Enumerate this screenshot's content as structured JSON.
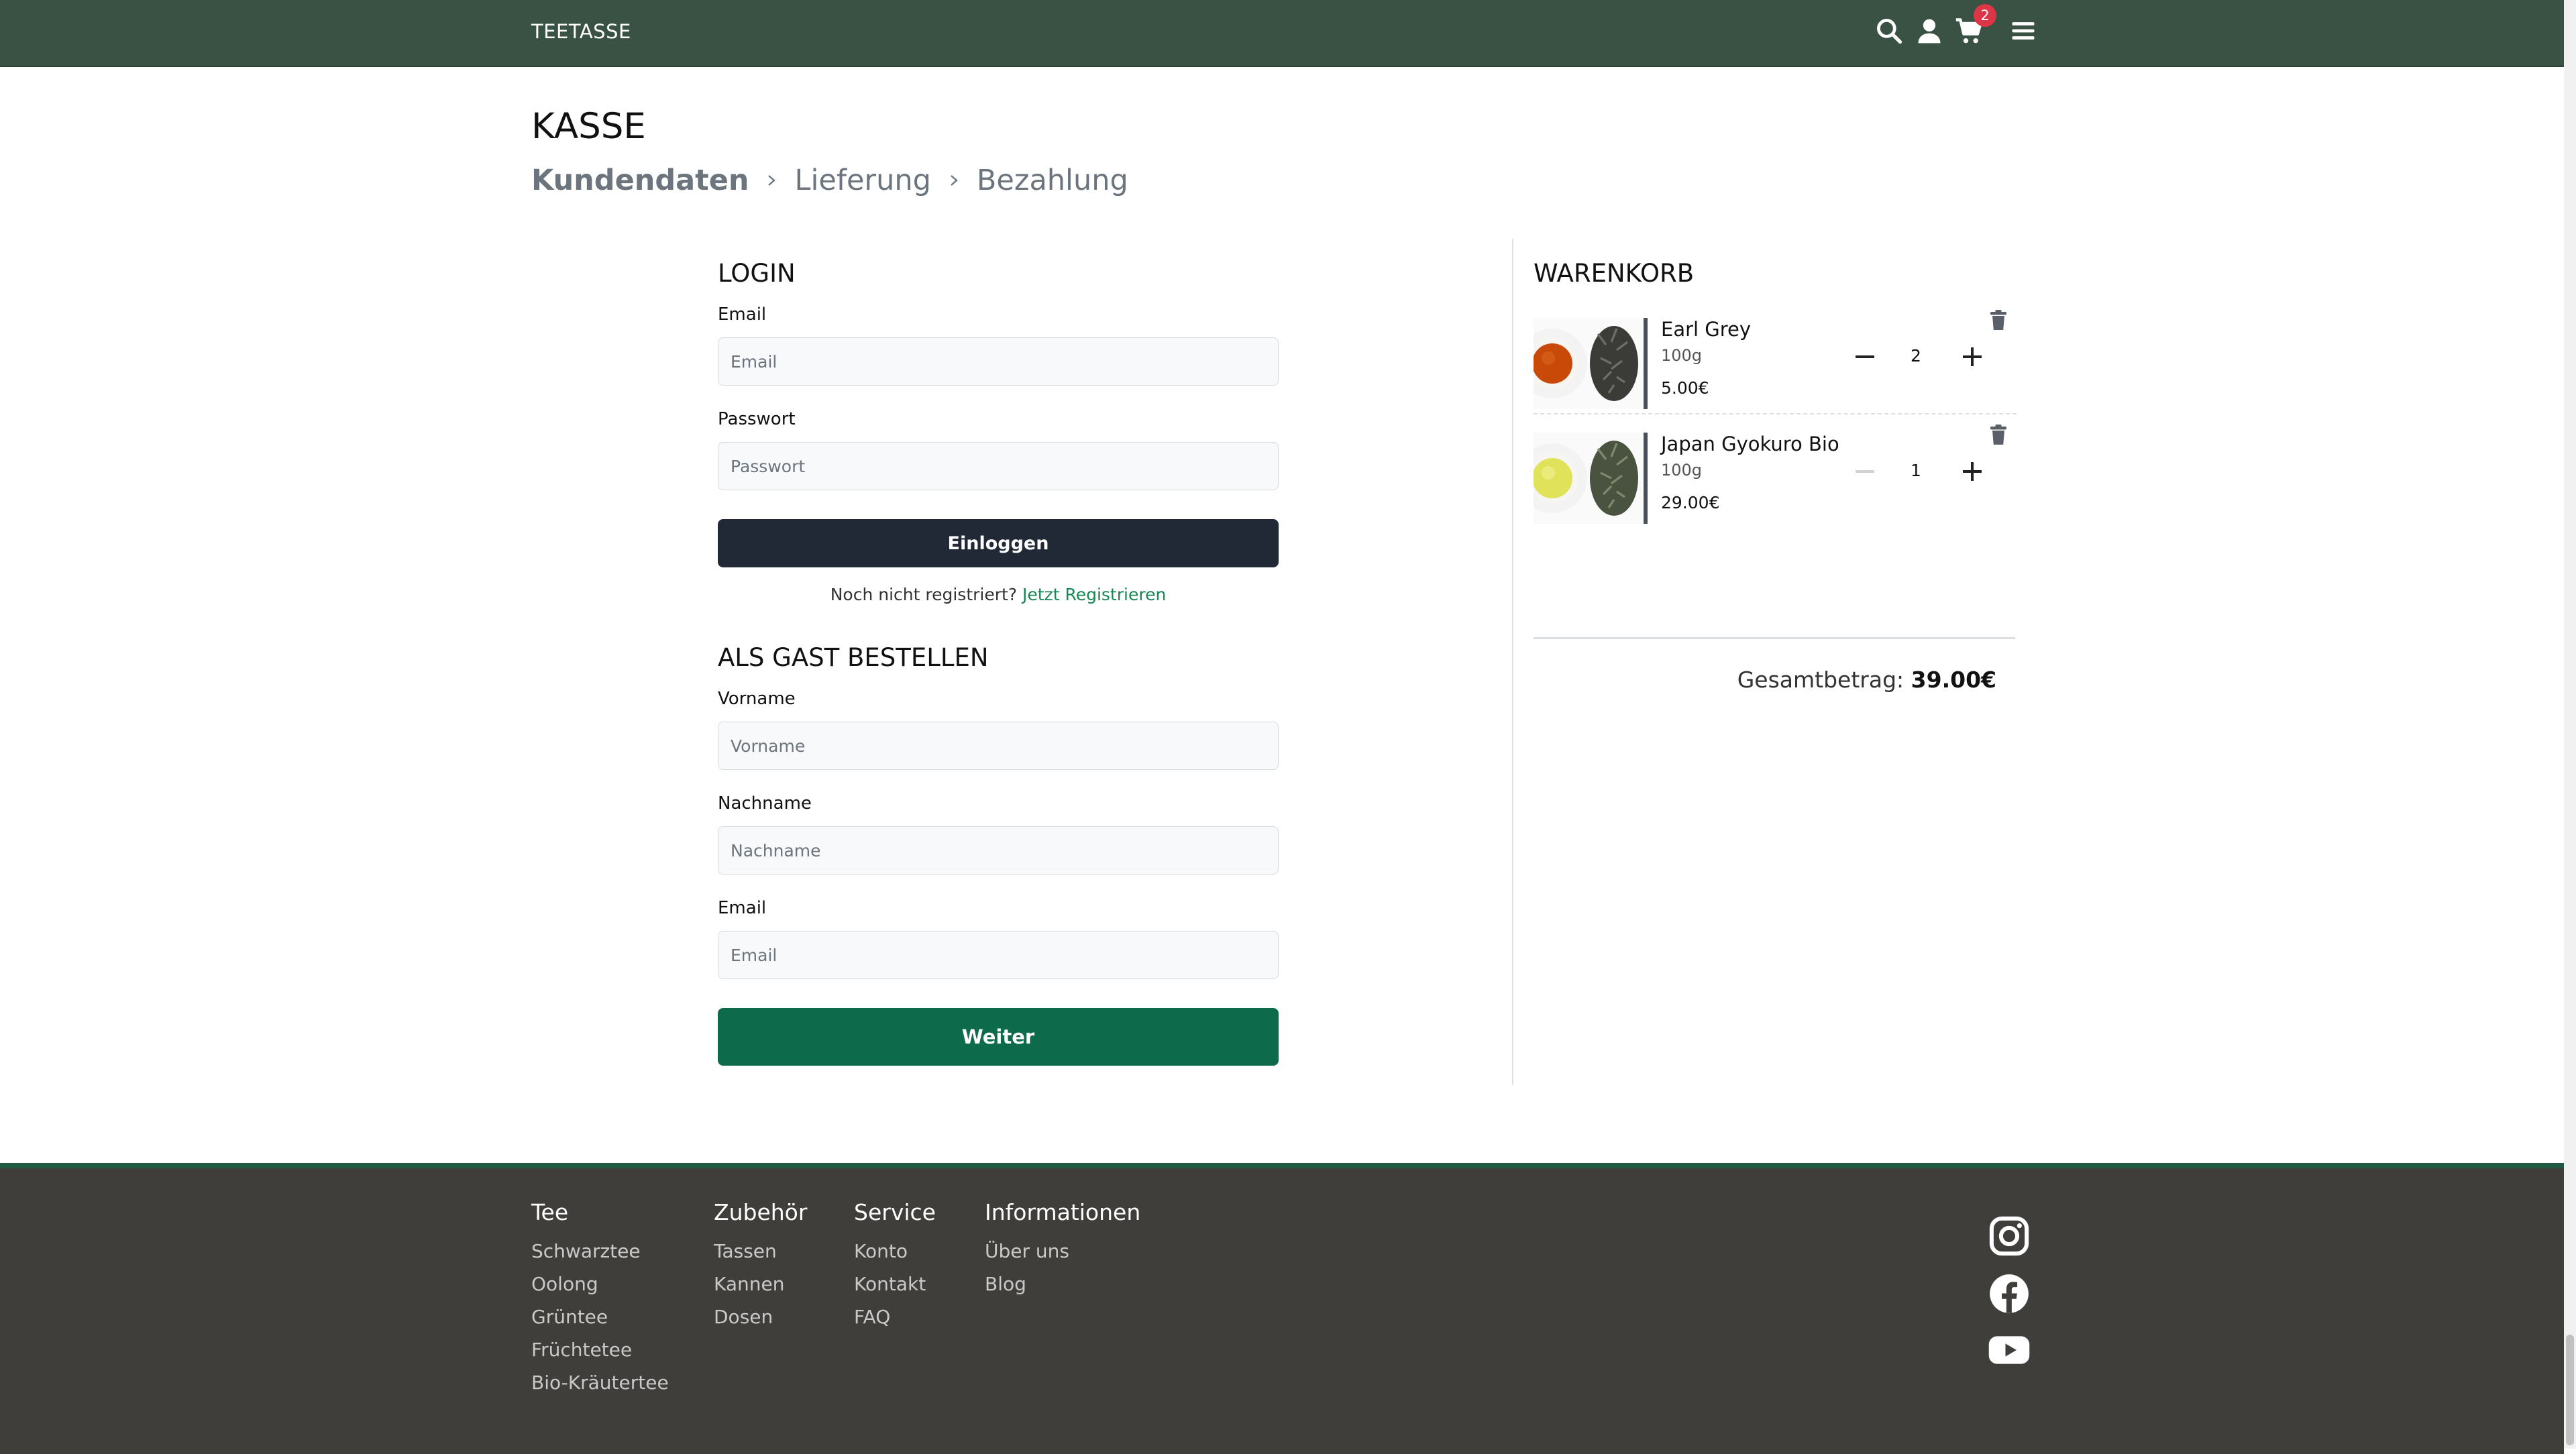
{
  "header": {
    "brand": "TEETASSE",
    "cart_count": "2",
    "icons": [
      "search-icon",
      "user-icon",
      "cart-icon",
      "menu-icon"
    ],
    "bg_color": "#3a5243"
  },
  "page": {
    "title": "KASSE",
    "steps": [
      {
        "label": "Kundendaten",
        "active": true
      },
      {
        "label": "Lieferung",
        "active": false
      },
      {
        "label": "Bezahlung",
        "active": false
      }
    ]
  },
  "login": {
    "title": "LOGIN",
    "email_label": "Email",
    "email_placeholder": "Email",
    "password_label": "Passwort",
    "password_placeholder": "Passwort",
    "button": "Einloggen",
    "register_prompt": "Noch nicht registriert?",
    "register_link": "Jetzt Registrieren"
  },
  "guest": {
    "title": "ALS GAST BESTELLEN",
    "firstname_label": "Vorname",
    "firstname_placeholder": "Vorname",
    "lastname_label": "Nachname",
    "lastname_placeholder": "Nachname",
    "email_label": "Email",
    "email_placeholder": "Email",
    "button": "Weiter"
  },
  "cart": {
    "title": "WARENKORB",
    "items": [
      {
        "name": "Earl Grey",
        "weight": "100g",
        "price": "5.00€",
        "qty": "2",
        "tea_color": "#c94a08"
      },
      {
        "name": "Japan Gyokuro Bio",
        "weight": "100g",
        "price": "29.00€",
        "qty": "1",
        "tea_color": "#e0e35a"
      }
    ],
    "total_label": "Gesamtbetrag:",
    "total_value": "39.00€"
  },
  "footer": {
    "columns": [
      {
        "title": "Tee",
        "links": [
          "Schwarztee",
          "Oolong",
          "Grüntee",
          "Früchtetee",
          "Bio-Kräutertee"
        ]
      },
      {
        "title": "Zubehör",
        "links": [
          "Tassen",
          "Kannen",
          "Dosen"
        ]
      },
      {
        "title": "Service",
        "links": [
          "Konto",
          "Kontakt",
          "FAQ"
        ]
      },
      {
        "title": "Informationen",
        "links": [
          "Über uns",
          "Blog"
        ]
      }
    ],
    "social": [
      "instagram-icon",
      "facebook-icon",
      "youtube-icon"
    ]
  },
  "colors": {
    "header": "#3a5243",
    "login_button": "#212936",
    "continue_button": "#0d6b4b",
    "link": "#198754",
    "footer": "#403e3b",
    "badge": "#dc3545"
  }
}
